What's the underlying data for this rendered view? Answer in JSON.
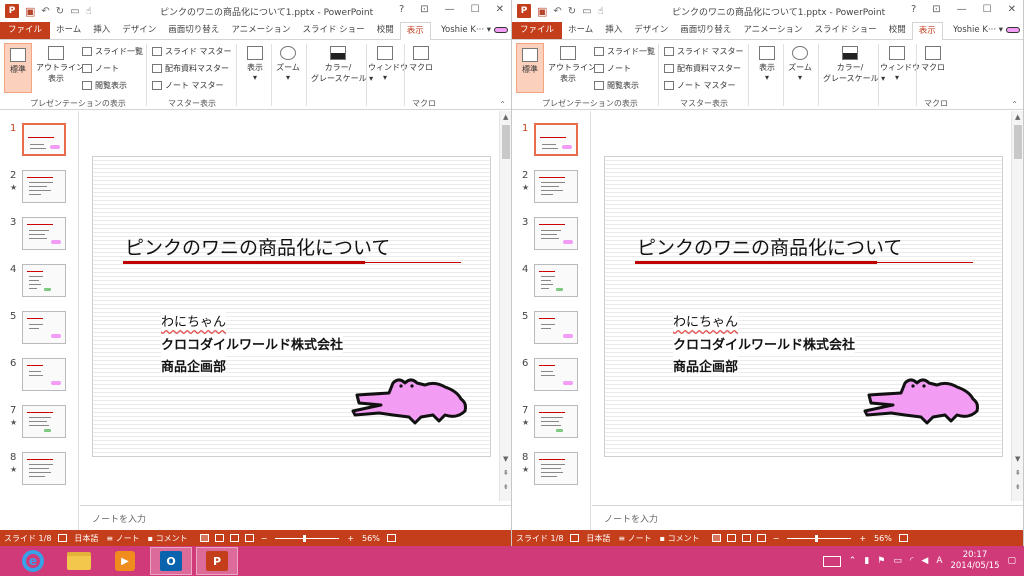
{
  "app": {
    "title": "ピンクのワニの商品化について1.pptx - PowerPoint",
    "help": "?",
    "user": "Yoshie K···",
    "ppt_glyph": "P"
  },
  "tabs": [
    "ファイル",
    "ホーム",
    "挿入",
    "デザイン",
    "画面切り替え",
    "アニメーション",
    "スライド ショー",
    "校閲",
    "表示"
  ],
  "ribbon": {
    "normal": "標準",
    "outline": "アウトライン表示",
    "outline_l1": "アウトライン",
    "outline_l2": "表示",
    "sorter": "スライド一覧",
    "notes": "ノート",
    "reading": "閲覧表示",
    "group_views": "プレゼンテーションの表示",
    "slide_master": "スライド マスター",
    "handout_master": "配布資料マスター",
    "notes_master": "ノート マスター",
    "group_master": "マスター表示",
    "show": "表示",
    "zoom": "ズーム",
    "color_l1": "カラー/",
    "color_l2": "グレースケール",
    "window": "ウィンドウ",
    "macro": "マクロ",
    "group_macro": "マクロ"
  },
  "slides": [
    {
      "num": "1",
      "star": ""
    },
    {
      "num": "2",
      "star": "★"
    },
    {
      "num": "3",
      "star": ""
    },
    {
      "num": "4",
      "star": ""
    },
    {
      "num": "5",
      "star": ""
    },
    {
      "num": "6",
      "star": ""
    },
    {
      "num": "7",
      "star": "★"
    },
    {
      "num": "8",
      "star": "★"
    }
  ],
  "slide": {
    "title": "ピンクのワニの商品化について",
    "line1": "わにちゃん",
    "line2": "クロコダイルワールド株式会社",
    "line3": "商品企画部"
  },
  "notes_placeholder": "ノートを入力",
  "status": {
    "slide": "スライド 1/8",
    "language": "日本語",
    "notes": "ノート",
    "comments": "コメント",
    "zoom": "56%"
  },
  "taskbar": {
    "time": "20:17",
    "date": "2014/05/15",
    "ime": "A"
  },
  "colors": {
    "accent": "#c43e1c",
    "taskbar": "#d03a78",
    "croc": "#f29cf4",
    "title_rule": "#c00000"
  },
  "icons": [
    "powerpoint-icon",
    "save-icon",
    "undo-icon",
    "redo-icon",
    "crocodile-icon",
    "ie-icon",
    "folder-icon",
    "media-player-icon",
    "outlook-icon",
    "keyboard-icon"
  ]
}
